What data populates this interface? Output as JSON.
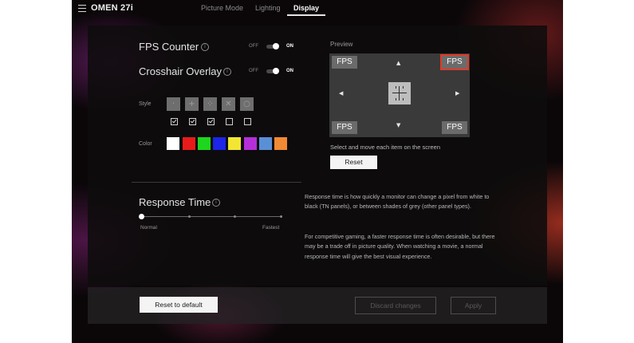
{
  "header": {
    "title": "OMEN 27i",
    "tabs": [
      {
        "label": "Picture Mode",
        "active": false
      },
      {
        "label": "Lighting",
        "active": false
      },
      {
        "label": "Display",
        "active": true
      }
    ]
  },
  "fps_counter": {
    "label": "FPS Counter",
    "off": "OFF",
    "on": "ON",
    "state": "on"
  },
  "crosshair_overlay": {
    "label": "Crosshair Overlay",
    "off": "OFF",
    "on": "ON",
    "state": "on"
  },
  "style": {
    "label": "Style",
    "options": [
      "·",
      "+",
      "⁘",
      "✕",
      "○"
    ],
    "checks": [
      true,
      true,
      true,
      false,
      false
    ]
  },
  "color": {
    "label": "Color",
    "swatches": [
      "#ffffff",
      "#e81b1b",
      "#1ed61e",
      "#1c25e8",
      "#f2e634",
      "#b42fd8",
      "#5a8fd6",
      "#f08a34"
    ]
  },
  "preview": {
    "label": "Preview",
    "fps_text": "FPS",
    "selected": "top-right",
    "hint": "Select and move each item on the screen",
    "reset_label": "Reset"
  },
  "response_time": {
    "label": "Response Time",
    "min_label": "Normal",
    "max_label": "Fastest",
    "value": 0,
    "steps": 4,
    "description_1": "Response time is how quickly a monitor can change a pixel from white to black (TN panels), or between shades of grey (other panel types).",
    "description_2": "For competitive gaming, a faster response time is often desirable, but there may be a trade off in picture quality. When watching a movie, a normal response time will give the best visual experience."
  },
  "footer": {
    "reset_default": "Reset to default",
    "discard": "Discard changes",
    "apply": "Apply"
  }
}
